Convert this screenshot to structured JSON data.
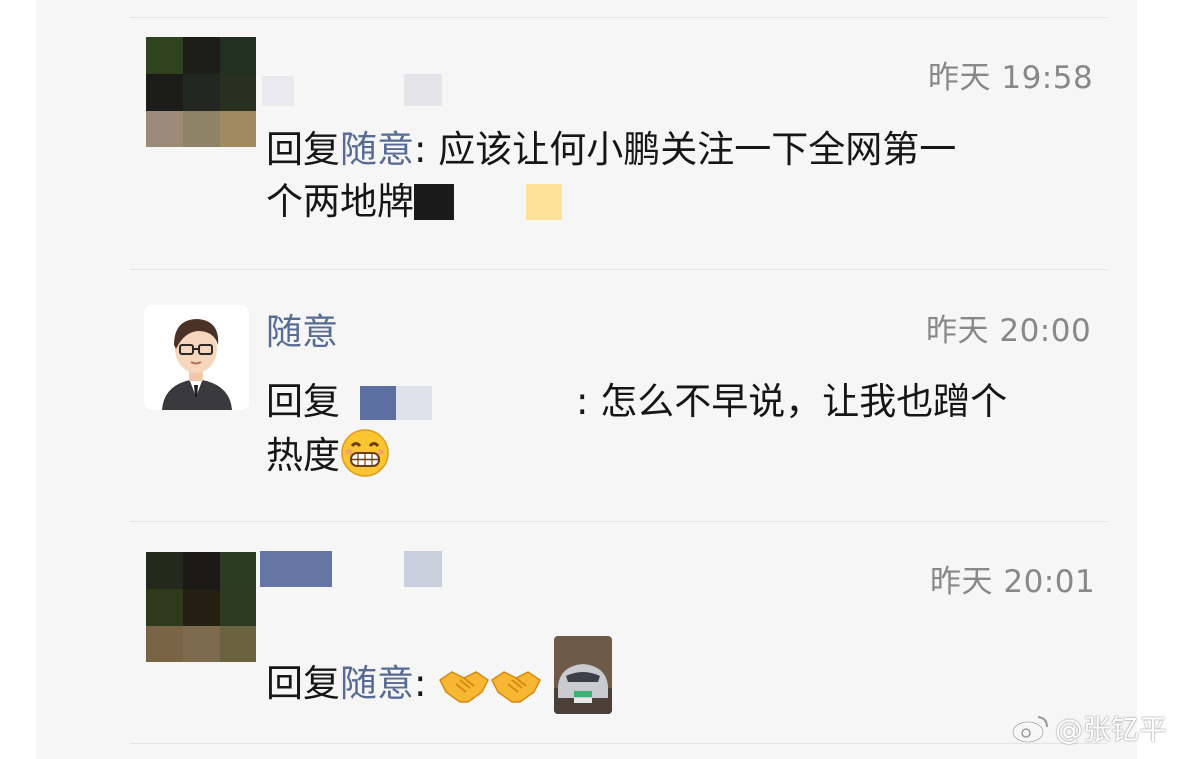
{
  "comments": [
    {
      "time": "昨天 19:58",
      "reply_prefix": "回复",
      "reply_to": "随意",
      "separator": ":",
      "text_line1": " 应该让何小鹏关注一下全网第一",
      "text_line2": "个两地牌"
    },
    {
      "author": "随意",
      "time": "昨天 20:00",
      "reply_prefix": "回复",
      "separator": ":",
      "text_line1": " 怎么不早说，让我也蹭个",
      "text_line2": "热度"
    },
    {
      "time": "昨天 20:01",
      "reply_prefix": "回复",
      "reply_to": "随意",
      "separator": ":"
    }
  ],
  "watermark": {
    "handle": "@张钇平",
    "icon": "weibo-icon"
  },
  "icons": {
    "grin": "grinning-face-icon",
    "handshake": "handshake-icon",
    "car_photo": "car-photo-thumbnail"
  },
  "colors": {
    "link": "#576b95",
    "time": "#888888",
    "text": "#161616",
    "panel": "#f6f6f6"
  }
}
